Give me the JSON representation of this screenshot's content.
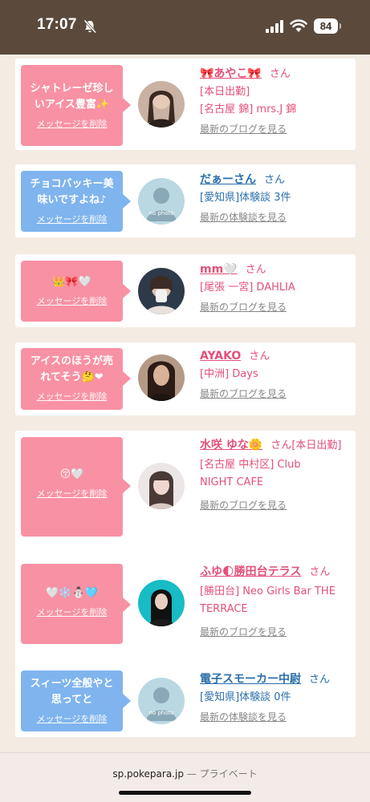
{
  "status_bar": {
    "time": "17:07",
    "battery": "84"
  },
  "colors": {
    "header_brown": "#5b4a3c",
    "background": "#f4ece3",
    "bubble_pink": "#f891a4",
    "bubble_blue": "#7fb4ee",
    "name_pink": "#e3507a",
    "name_blue": "#2b6faa"
  },
  "delete_label": "メッセージを削除",
  "cards": [
    {
      "bubble_color": "pink",
      "message_lines": [
        "シャトレーゼ珍し",
        "いアイス豊富✨"
      ],
      "avatar_icon": "photo-avatar",
      "name": "🎀あやこ🎀",
      "suffix": "さん",
      "details": [
        "[本日出勤]",
        "[名古屋 錦] mrs.J 錦"
      ],
      "link": "最新のブログを見る"
    },
    {
      "bubble_color": "blue",
      "message_lines": [
        "チョコバッキー美",
        "味いですよね♪"
      ],
      "avatar_icon": "no-photo-avatar",
      "name": "だぁーさん",
      "suffix": "さん",
      "details": [
        "[愛知県]体験談 3件"
      ],
      "link": "最新の体験談を見る"
    },
    {
      "bubble_color": "pink",
      "message_lines": [
        "👑🎀🤍"
      ],
      "avatar_icon": "photo-avatar",
      "name": "mm🤍",
      "suffix": "さん",
      "details": [
        "[尾張 一宮] DAHLIA"
      ],
      "link": "最新のブログを見る"
    },
    {
      "bubble_color": "pink",
      "message_lines": [
        "アイスのほうが売",
        "れてそう🤔❤"
      ],
      "avatar_icon": "photo-avatar",
      "name": "AYAKO",
      "suffix": "さん",
      "details": [
        "[中洲] Days"
      ],
      "link": "最新のブログを見る"
    },
    {
      "bubble_color": "pink",
      "message_lines": [
        "😚🤍"
      ],
      "avatar_icon": "photo-avatar",
      "name": "水咲 ゆな🌼",
      "suffix": "さん[本日出勤]",
      "details": [
        "[名古屋 中村区] Club",
        "NIGHT CAFE"
      ],
      "link": "最新のブログを見る"
    },
    {
      "bubble_color": "pink",
      "message_lines": [
        "🤍❄️⛄🩵"
      ],
      "avatar_icon": "photo-avatar",
      "name": "ふゆ🌓勝田台テラス",
      "suffix": "さん",
      "details": [
        "[勝田台] Neo Girls Bar THE",
        "TERRACE"
      ],
      "link": "最新のブログを見る"
    },
    {
      "bubble_color": "blue",
      "message_lines": [
        "スィーツ全般やと",
        "思ってと"
      ],
      "avatar_icon": "no-photo-avatar",
      "name": "電子スモーカー中尉",
      "suffix": "さん",
      "details": [
        "[愛知県]体験談 0件"
      ],
      "link": "最新の体験談を見る"
    }
  ],
  "browser": {
    "url": "sp.pokepara.jp",
    "separator": " — ",
    "mode": "プライベート"
  }
}
